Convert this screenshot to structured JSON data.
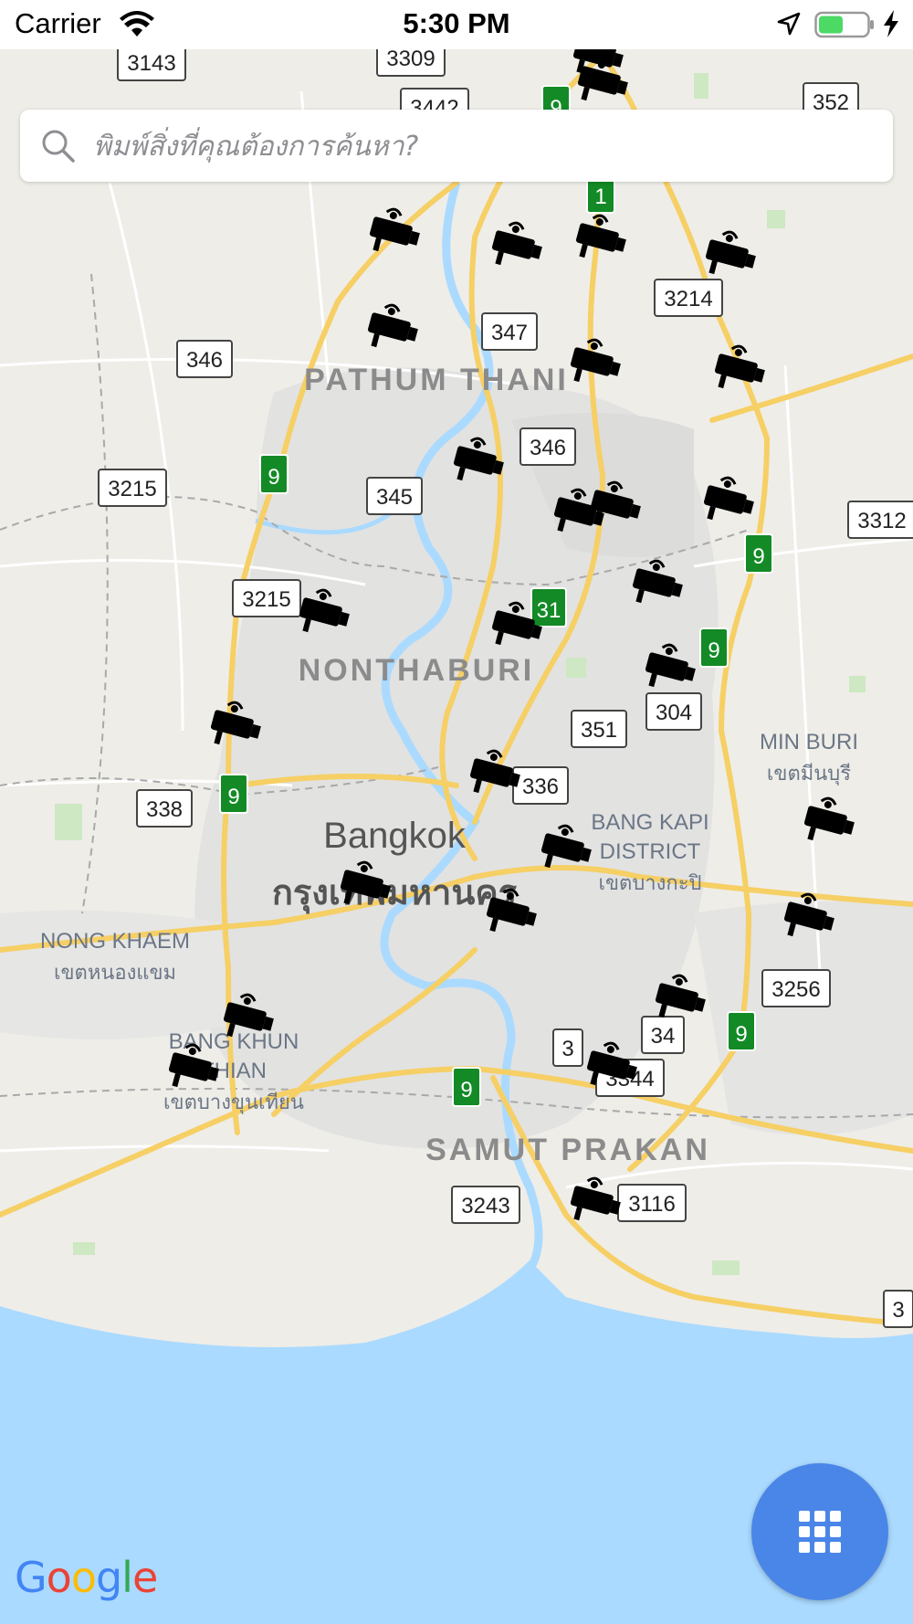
{
  "status_bar": {
    "carrier": "Carrier",
    "time": "5:30 PM"
  },
  "search": {
    "placeholder": "พิมพ์สิ่งที่คุณต้องการค้นหา?"
  },
  "map": {
    "area_labels": [
      "PATHUM THANI",
      "NONTHABURI",
      "Bangkok",
      "กรุงเทพมหานคร",
      "MIN BURI",
      "เขตมีนบุรี",
      "BANG KAPI",
      "DISTRICT",
      "เขตบางกะปิ",
      "NONG KHAEM",
      "เขตหนองแขม",
      "BANG KHUN",
      "THIAN",
      "เขตบางขุนเทียน",
      "SAMUT PRAKAN"
    ],
    "route_shields": [
      "3143",
      "3309",
      "3442",
      "352",
      "3214",
      "347",
      "346",
      "346",
      "3215",
      "345",
      "3312",
      "3215",
      "304",
      "351",
      "336",
      "338",
      "3256",
      "34",
      "3",
      "3344",
      "3243",
      "3116",
      "3"
    ],
    "highway_shields": [
      "9",
      "1",
      "9",
      "9",
      "31",
      "9",
      "9",
      "9",
      "9"
    ],
    "camera_count": 29
  },
  "fab": {
    "icon": "grid-icon"
  },
  "attribution": {
    "logo": "Google"
  }
}
